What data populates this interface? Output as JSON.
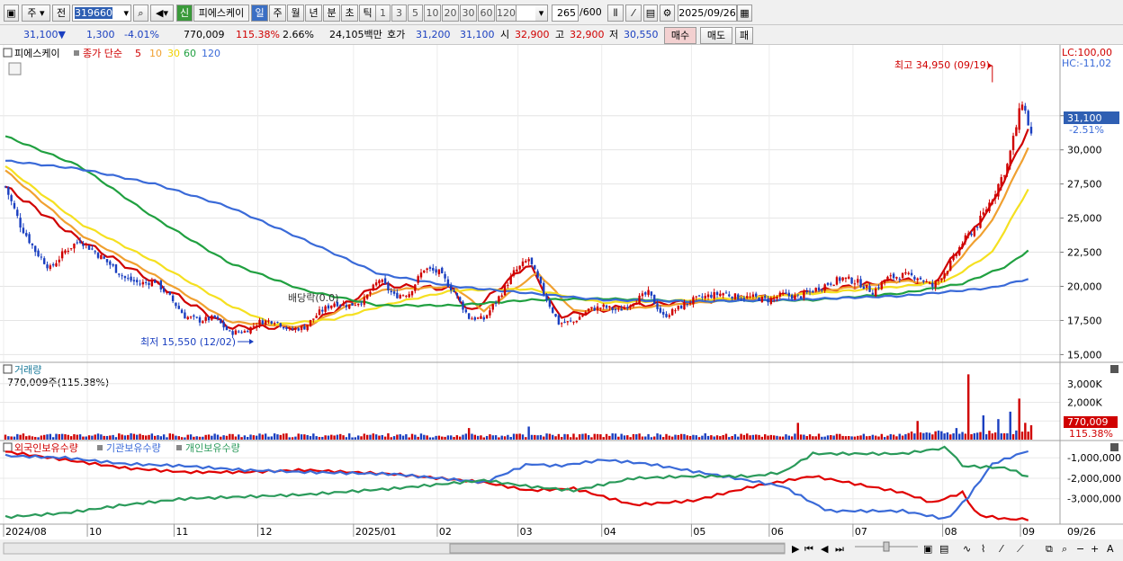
{
  "toolbar": {
    "type_label": "주",
    "prev_label": "전",
    "stock_code": "319660",
    "badge_label": "신",
    "stock_name": "피에스케이",
    "periods": [
      "일",
      "주",
      "월",
      "년",
      "분",
      "초",
      "틱"
    ],
    "active_period": "일",
    "intervals": [
      "1",
      "3",
      "5",
      "10",
      "20",
      "30",
      "60",
      "120"
    ],
    "count_value": "265",
    "count_total": "/600",
    "date_value": "2025/09/26"
  },
  "info": {
    "price": "31,100",
    "change_arrow": "▼",
    "change": "1,300",
    "change_pct": "-4.01%",
    "volume": "770,009",
    "volume_ratio": "115.38%",
    "turnover": "2.66%",
    "amount": "24,105백만",
    "bid_label": "호가",
    "bid": "31,200",
    "ask": "31,100",
    "open_label": "시",
    "open": "32,900",
    "high_label": "고",
    "high": "32,900",
    "low_label": "저",
    "low": "30,550",
    "buy_label": "매수",
    "sell_label": "매도",
    "extra_label": "패"
  },
  "colors": {
    "up": "#d00000",
    "down": "#1a3fc0",
    "ma5": "#d00000",
    "ma10": "#f0a030",
    "ma30": "#f5e020",
    "ma60": "#20a040",
    "ma120": "#3a6ad8",
    "foreign": "#e00000",
    "institution": "#3a6ad8",
    "individual": "#2a9a5a"
  },
  "chart_data": [
    {
      "type": "line",
      "title": "피에스케이",
      "legend": {
        "label": "종가 단순",
        "series": [
          "5",
          "10",
          "30",
          "60",
          "120"
        ]
      },
      "x_ticks": [
        "2024/08",
        "10",
        "11",
        "12",
        "2025/01",
        "02",
        "03",
        "04",
        "05",
        "06",
        "07",
        "08",
        "09",
        "09/26"
      ],
      "y_ticks": [
        "32,500",
        "30,000",
        "27,500",
        "25,000",
        "22,500",
        "20,000",
        "17,500",
        "15,000"
      ],
      "ylim": [
        14500,
        36500
      ],
      "corner_labels": [
        "LC:100,00",
        "HC:-11,02"
      ],
      "current_price_label": "31,100",
      "current_change_label": "-2.51%",
      "annotations": {
        "high": "최고 34,950 (09/19)",
        "low": "최저 15,550 (12/02)",
        "dividend": "배당락(0.0)"
      },
      "close_points": [
        [
          0,
          27300
        ],
        [
          5,
          24500
        ],
        [
          10,
          22600
        ],
        [
          15,
          21300
        ],
        [
          20,
          22600
        ],
        [
          25,
          23400
        ],
        [
          30,
          22500
        ],
        [
          35,
          21600
        ],
        [
          40,
          20600
        ],
        [
          45,
          20200
        ],
        [
          50,
          20400
        ],
        [
          55,
          19200
        ],
        [
          60,
          17800
        ],
        [
          65,
          17500
        ],
        [
          70,
          17700
        ],
        [
          75,
          16600
        ],
        [
          80,
          16700
        ],
        [
          85,
          17400
        ],
        [
          90,
          17500
        ],
        [
          95,
          16800
        ],
        [
          100,
          17000
        ],
        [
          105,
          18100
        ],
        [
          110,
          18800
        ],
        [
          115,
          18600
        ],
        [
          120,
          19000
        ],
        [
          125,
          20500
        ],
        [
          130,
          19300
        ],
        [
          135,
          19500
        ],
        [
          140,
          21300
        ],
        [
          145,
          21000
        ],
        [
          150,
          19600
        ],
        [
          155,
          17700
        ],
        [
          160,
          17600
        ],
        [
          165,
          19200
        ],
        [
          170,
          21000
        ],
        [
          175,
          22000
        ],
        [
          180,
          19500
        ],
        [
          185,
          17300
        ],
        [
          190,
          17400
        ],
        [
          195,
          18300
        ],
        [
          200,
          18500
        ],
        [
          205,
          18200
        ],
        [
          210,
          18900
        ],
        [
          215,
          19500
        ],
        [
          220,
          17800
        ],
        [
          225,
          18400
        ],
        [
          230,
          19000
        ],
        [
          235,
          19300
        ],
        [
          240,
          19500
        ],
        [
          245,
          19200
        ],
        [
          250,
          19200
        ],
        [
          255,
          19000
        ],
        [
          260,
          19400
        ],
        [
          265,
          19200
        ],
        [
          270,
          19700
        ],
        [
          275,
          20200
        ],
        [
          280,
          20600
        ],
        [
          285,
          20300
        ],
        [
          290,
          19600
        ],
        [
          295,
          20600
        ],
        [
          300,
          20800
        ],
        [
          305,
          20700
        ],
        [
          310,
          20000
        ],
        [
          315,
          21300
        ],
        [
          320,
          23200
        ],
        [
          325,
          24500
        ],
        [
          330,
          26500
        ],
        [
          335,
          28900
        ],
        [
          340,
          33600
        ],
        [
          343,
          31100
        ]
      ],
      "ma_series": [
        {
          "name": "5",
          "points": [
            [
              0,
              27300
            ],
            [
              25,
              23400
            ],
            [
              50,
              20300
            ],
            [
              75,
              17000
            ],
            [
              100,
              17000
            ],
            [
              125,
              20100
            ],
            [
              150,
              19800
            ],
            [
              155,
              18000
            ],
            [
              175,
              21700
            ],
            [
              185,
              17800
            ],
            [
              210,
              18600
            ],
            [
              260,
              19300
            ],
            [
              300,
              20500
            ],
            [
              310,
              20100
            ],
            [
              330,
              26000
            ],
            [
              343,
              32000
            ]
          ]
        },
        {
          "name": "10",
          "points": [
            [
              0,
              28500
            ],
            [
              25,
              23800
            ],
            [
              50,
              20800
            ],
            [
              75,
              17400
            ],
            [
              100,
              17000
            ],
            [
              125,
              19700
            ],
            [
              150,
              20000
            ],
            [
              160,
              18200
            ],
            [
              178,
              21000
            ],
            [
              190,
              18200
            ],
            [
              210,
              18400
            ],
            [
              260,
              19300
            ],
            [
              300,
              20400
            ],
            [
              312,
              20200
            ],
            [
              330,
              24800
            ],
            [
              343,
              30600
            ]
          ]
        },
        {
          "name": "30",
          "points": [
            [
              0,
              28800
            ],
            [
              25,
              24600
            ],
            [
              50,
              21800
            ],
            [
              75,
              18600
            ],
            [
              90,
              17200
            ],
            [
              110,
              17600
            ],
            [
              130,
              18800
            ],
            [
              150,
              19700
            ],
            [
              175,
              19800
            ],
            [
              200,
              18800
            ],
            [
              230,
              19000
            ],
            [
              260,
              19300
            ],
            [
              300,
              20000
            ],
            [
              315,
              20400
            ],
            [
              330,
              22500
            ],
            [
              343,
              27500
            ]
          ]
        },
        {
          "name": "60",
          "points": [
            [
              0,
              31000
            ],
            [
              25,
              28800
            ],
            [
              50,
              25000
            ],
            [
              75,
              21700
            ],
            [
              100,
              19700
            ],
            [
              125,
              18600
            ],
            [
              150,
              18600
            ],
            [
              175,
              19000
            ],
            [
              200,
              19100
            ],
            [
              230,
              18900
            ],
            [
              270,
              19000
            ],
            [
              300,
              19500
            ],
            [
              320,
              20200
            ],
            [
              335,
              21500
            ],
            [
              343,
              22800
            ]
          ]
        },
        {
          "name": "120",
          "points": [
            [
              0,
              29200
            ],
            [
              25,
              28600
            ],
            [
              50,
              27500
            ],
            [
              75,
              25800
            ],
            [
              100,
              23400
            ],
            [
              125,
              20900
            ],
            [
              150,
              20000
            ],
            [
              175,
              19500
            ],
            [
              200,
              19000
            ],
            [
              230,
              18900
            ],
            [
              260,
              19000
            ],
            [
              300,
              19300
            ],
            [
              330,
              19900
            ],
            [
              343,
              20600
            ]
          ]
        }
      ]
    },
    {
      "type": "bar",
      "title": "거래량",
      "value_label": "770,009주(115.38%)",
      "y_ticks": [
        "3,000K",
        "2,000K",
        "1,000K"
      ],
      "ylim": [
        0,
        4000000
      ],
      "current_label": "770,009",
      "current_pct_label": "115.38%",
      "spikes": [
        [
          155,
          620000
        ],
        [
          175,
          700000
        ],
        [
          265,
          900000
        ],
        [
          305,
          1000000
        ],
        [
          318,
          620000
        ],
        [
          322,
          3500000
        ],
        [
          327,
          1300000
        ],
        [
          332,
          1100000
        ],
        [
          336,
          1500000
        ],
        [
          339,
          2200000
        ],
        [
          341,
          900000
        ],
        [
          343,
          770009
        ]
      ]
    },
    {
      "type": "line",
      "series_labels": [
        "외국인보유수량",
        "기관보유수량",
        "개인보유수량"
      ],
      "y_ticks": [
        "-1,000,000",
        "-2,000,000",
        "-3,000,000"
      ],
      "ylim": [
        -4200000,
        -200000
      ],
      "series": [
        {
          "name": "외국인보유수량",
          "points": [
            [
              0,
              -700000
            ],
            [
              20,
              -1100000
            ],
            [
              40,
              -1500000
            ],
            [
              60,
              -1700000
            ],
            [
              80,
              -1700000
            ],
            [
              100,
              -1600000
            ],
            [
              130,
              -1800000
            ],
            [
              160,
              -2200000
            ],
            [
              175,
              -2600000
            ],
            [
              190,
              -2500000
            ],
            [
              210,
              -3300000
            ],
            [
              230,
              -3100000
            ],
            [
              250,
              -2400000
            ],
            [
              270,
              -1900000
            ],
            [
              300,
              -2700000
            ],
            [
              310,
              -3200000
            ],
            [
              320,
              -2700000
            ],
            [
              325,
              -3800000
            ],
            [
              335,
              -4000000
            ],
            [
              343,
              -4000000
            ]
          ]
        },
        {
          "name": "기관보유수량",
          "points": [
            [
              0,
              -900000
            ],
            [
              20,
              -1000000
            ],
            [
              40,
              -1300000
            ],
            [
              60,
              -1400000
            ],
            [
              80,
              -1600000
            ],
            [
              100,
              -1700000
            ],
            [
              130,
              -1800000
            ],
            [
              160,
              -2200000
            ],
            [
              175,
              -1300000
            ],
            [
              185,
              -1400000
            ],
            [
              200,
              -1100000
            ],
            [
              215,
              -1300000
            ],
            [
              240,
              -1900000
            ],
            [
              260,
              -2400000
            ],
            [
              275,
              -3600000
            ],
            [
              300,
              -3600000
            ],
            [
              315,
              -4000000
            ],
            [
              322,
              -2900000
            ],
            [
              330,
              -1300000
            ],
            [
              343,
              -600000
            ]
          ]
        },
        {
          "name": "개인보유수량",
          "points": [
            [
              0,
              -3900000
            ],
            [
              20,
              -3700000
            ],
            [
              40,
              -3300000
            ],
            [
              60,
              -3000000
            ],
            [
              80,
              -2900000
            ],
            [
              100,
              -2800000
            ],
            [
              130,
              -2500000
            ],
            [
              160,
              -2100000
            ],
            [
              175,
              -2400000
            ],
            [
              190,
              -2600000
            ],
            [
              210,
              -2000000
            ],
            [
              230,
              -1900000
            ],
            [
              250,
              -1900000
            ],
            [
              260,
              -1700000
            ],
            [
              270,
              -800000
            ],
            [
              300,
              -800000
            ],
            [
              315,
              -500000
            ],
            [
              320,
              -1400000
            ],
            [
              335,
              -1500000
            ],
            [
              343,
              -2000000
            ]
          ]
        }
      ]
    }
  ]
}
